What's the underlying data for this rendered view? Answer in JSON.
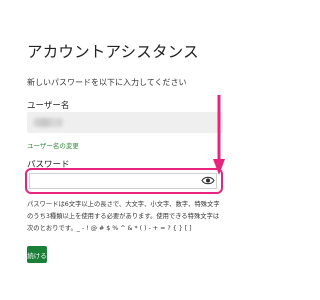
{
  "page": {
    "title": "アカウントアシスタンス",
    "instruction": "新しいパスワードを以下に入力してください"
  },
  "username": {
    "label": "ユーザー名",
    "value": ""
  },
  "change_username_link": "ユーザー名の変更",
  "password": {
    "label": "パスワード",
    "value": "",
    "placeholder": "",
    "toggle_icon": "eye-icon"
  },
  "password_policy": "パスワードは6文字以上の長さで、大文字、小文字、数字、特殊文字のうち3種類以上を使用する必要があります。使用できる特殊文字は次のとおりです。_ - ! @ # $ % ^ & * ( ) - + = ? { } [ ]",
  "continue_button": "続ける",
  "colors": {
    "accent_green": "#1a7f37",
    "link_green": "#2f8a3c",
    "highlight_pink": "#e8247f"
  }
}
